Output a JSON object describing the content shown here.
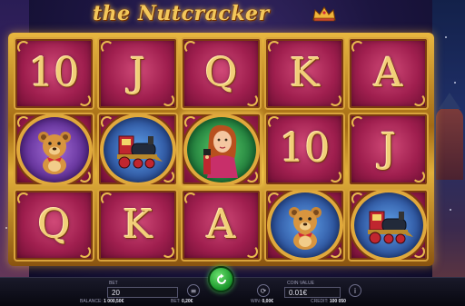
{
  "game": {
    "title": "the Nutcracker"
  },
  "reels": {
    "rows": [
      [
        "10",
        "J",
        "Q",
        "K",
        "A"
      ],
      [
        "teddy-bear",
        "toy-train",
        "nutcracker-girl",
        "10",
        "J"
      ],
      [
        "Q",
        "K",
        "A",
        "teddy-bear",
        "toy-train"
      ]
    ],
    "row1": {
      "c1": "10",
      "c2": "J",
      "c3": "Q",
      "c4": "K",
      "c5": "A"
    },
    "row2": {
      "c4": "10",
      "c5": "J"
    },
    "row3": {
      "c1": "Q",
      "c2": "K",
      "c3": "A"
    }
  },
  "controls": {
    "bet_label": "BET",
    "bet_value": "20",
    "balance_label": "BALANCE:",
    "balance_value": "1 000,50€",
    "bet2_label": "BET:",
    "bet2_value": "0,20€",
    "win_label": "WIN:",
    "win_value": "0,00€",
    "coin_label": "COIN VALUE",
    "coin_value": "0.01€",
    "credit_label": "CREDIT:",
    "credit_value": "100 050"
  },
  "colors": {
    "card_bg": "#a01f4f",
    "frame_gold": "#e2b03a",
    "spin_green": "#1e9a2e"
  }
}
